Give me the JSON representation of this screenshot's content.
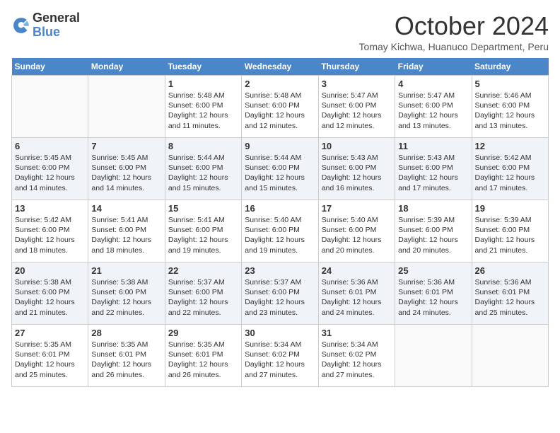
{
  "logo": {
    "line1": "General",
    "line2": "Blue"
  },
  "title": "October 2024",
  "subtitle": "Tomay Kichwa, Huanuco Department, Peru",
  "weekdays": [
    "Sunday",
    "Monday",
    "Tuesday",
    "Wednesday",
    "Thursday",
    "Friday",
    "Saturday"
  ],
  "weeks": [
    [
      {
        "day": "",
        "sunrise": "",
        "sunset": "",
        "daylight": ""
      },
      {
        "day": "",
        "sunrise": "",
        "sunset": "",
        "daylight": ""
      },
      {
        "day": "1",
        "sunrise": "Sunrise: 5:48 AM",
        "sunset": "Sunset: 6:00 PM",
        "daylight": "Daylight: 12 hours and 11 minutes."
      },
      {
        "day": "2",
        "sunrise": "Sunrise: 5:48 AM",
        "sunset": "Sunset: 6:00 PM",
        "daylight": "Daylight: 12 hours and 12 minutes."
      },
      {
        "day": "3",
        "sunrise": "Sunrise: 5:47 AM",
        "sunset": "Sunset: 6:00 PM",
        "daylight": "Daylight: 12 hours and 12 minutes."
      },
      {
        "day": "4",
        "sunrise": "Sunrise: 5:47 AM",
        "sunset": "Sunset: 6:00 PM",
        "daylight": "Daylight: 12 hours and 13 minutes."
      },
      {
        "day": "5",
        "sunrise": "Sunrise: 5:46 AM",
        "sunset": "Sunset: 6:00 PM",
        "daylight": "Daylight: 12 hours and 13 minutes."
      }
    ],
    [
      {
        "day": "6",
        "sunrise": "Sunrise: 5:45 AM",
        "sunset": "Sunset: 6:00 PM",
        "daylight": "Daylight: 12 hours and 14 minutes."
      },
      {
        "day": "7",
        "sunrise": "Sunrise: 5:45 AM",
        "sunset": "Sunset: 6:00 PM",
        "daylight": "Daylight: 12 hours and 14 minutes."
      },
      {
        "day": "8",
        "sunrise": "Sunrise: 5:44 AM",
        "sunset": "Sunset: 6:00 PM",
        "daylight": "Daylight: 12 hours and 15 minutes."
      },
      {
        "day": "9",
        "sunrise": "Sunrise: 5:44 AM",
        "sunset": "Sunset: 6:00 PM",
        "daylight": "Daylight: 12 hours and 15 minutes."
      },
      {
        "day": "10",
        "sunrise": "Sunrise: 5:43 AM",
        "sunset": "Sunset: 6:00 PM",
        "daylight": "Daylight: 12 hours and 16 minutes."
      },
      {
        "day": "11",
        "sunrise": "Sunrise: 5:43 AM",
        "sunset": "Sunset: 6:00 PM",
        "daylight": "Daylight: 12 hours and 17 minutes."
      },
      {
        "day": "12",
        "sunrise": "Sunrise: 5:42 AM",
        "sunset": "Sunset: 6:00 PM",
        "daylight": "Daylight: 12 hours and 17 minutes."
      }
    ],
    [
      {
        "day": "13",
        "sunrise": "Sunrise: 5:42 AM",
        "sunset": "Sunset: 6:00 PM",
        "daylight": "Daylight: 12 hours and 18 minutes."
      },
      {
        "day": "14",
        "sunrise": "Sunrise: 5:41 AM",
        "sunset": "Sunset: 6:00 PM",
        "daylight": "Daylight: 12 hours and 18 minutes."
      },
      {
        "day": "15",
        "sunrise": "Sunrise: 5:41 AM",
        "sunset": "Sunset: 6:00 PM",
        "daylight": "Daylight: 12 hours and 19 minutes."
      },
      {
        "day": "16",
        "sunrise": "Sunrise: 5:40 AM",
        "sunset": "Sunset: 6:00 PM",
        "daylight": "Daylight: 12 hours and 19 minutes."
      },
      {
        "day": "17",
        "sunrise": "Sunrise: 5:40 AM",
        "sunset": "Sunset: 6:00 PM",
        "daylight": "Daylight: 12 hours and 20 minutes."
      },
      {
        "day": "18",
        "sunrise": "Sunrise: 5:39 AM",
        "sunset": "Sunset: 6:00 PM",
        "daylight": "Daylight: 12 hours and 20 minutes."
      },
      {
        "day": "19",
        "sunrise": "Sunrise: 5:39 AM",
        "sunset": "Sunset: 6:00 PM",
        "daylight": "Daylight: 12 hours and 21 minutes."
      }
    ],
    [
      {
        "day": "20",
        "sunrise": "Sunrise: 5:38 AM",
        "sunset": "Sunset: 6:00 PM",
        "daylight": "Daylight: 12 hours and 21 minutes."
      },
      {
        "day": "21",
        "sunrise": "Sunrise: 5:38 AM",
        "sunset": "Sunset: 6:00 PM",
        "daylight": "Daylight: 12 hours and 22 minutes."
      },
      {
        "day": "22",
        "sunrise": "Sunrise: 5:37 AM",
        "sunset": "Sunset: 6:00 PM",
        "daylight": "Daylight: 12 hours and 22 minutes."
      },
      {
        "day": "23",
        "sunrise": "Sunrise: 5:37 AM",
        "sunset": "Sunset: 6:00 PM",
        "daylight": "Daylight: 12 hours and 23 minutes."
      },
      {
        "day": "24",
        "sunrise": "Sunrise: 5:36 AM",
        "sunset": "Sunset: 6:01 PM",
        "daylight": "Daylight: 12 hours and 24 minutes."
      },
      {
        "day": "25",
        "sunrise": "Sunrise: 5:36 AM",
        "sunset": "Sunset: 6:01 PM",
        "daylight": "Daylight: 12 hours and 24 minutes."
      },
      {
        "day": "26",
        "sunrise": "Sunrise: 5:36 AM",
        "sunset": "Sunset: 6:01 PM",
        "daylight": "Daylight: 12 hours and 25 minutes."
      }
    ],
    [
      {
        "day": "27",
        "sunrise": "Sunrise: 5:35 AM",
        "sunset": "Sunset: 6:01 PM",
        "daylight": "Daylight: 12 hours and 25 minutes."
      },
      {
        "day": "28",
        "sunrise": "Sunrise: 5:35 AM",
        "sunset": "Sunset: 6:01 PM",
        "daylight": "Daylight: 12 hours and 26 minutes."
      },
      {
        "day": "29",
        "sunrise": "Sunrise: 5:35 AM",
        "sunset": "Sunset: 6:01 PM",
        "daylight": "Daylight: 12 hours and 26 minutes."
      },
      {
        "day": "30",
        "sunrise": "Sunrise: 5:34 AM",
        "sunset": "Sunset: 6:02 PM",
        "daylight": "Daylight: 12 hours and 27 minutes."
      },
      {
        "day": "31",
        "sunrise": "Sunrise: 5:34 AM",
        "sunset": "Sunset: 6:02 PM",
        "daylight": "Daylight: 12 hours and 27 minutes."
      },
      {
        "day": "",
        "sunrise": "",
        "sunset": "",
        "daylight": ""
      },
      {
        "day": "",
        "sunrise": "",
        "sunset": "",
        "daylight": ""
      }
    ]
  ]
}
